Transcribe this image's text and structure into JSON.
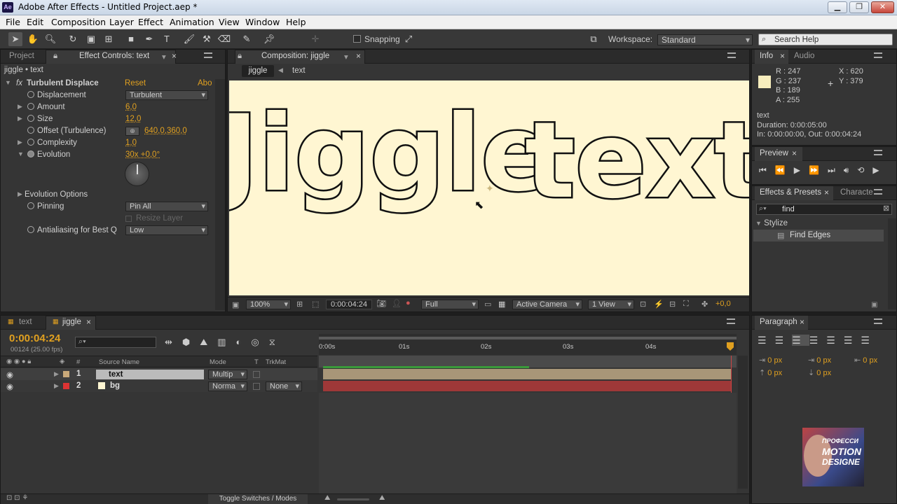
{
  "window": {
    "title": "Adobe After Effects - Untitled Project.aep *",
    "app_icon": "Ae"
  },
  "menu": [
    "File",
    "Edit",
    "Composition",
    "Layer",
    "Effect",
    "Animation",
    "View",
    "Window",
    "Help"
  ],
  "toolbar": {
    "snapping": "Snapping",
    "workspace_label": "Workspace:",
    "workspace_value": "Standard",
    "search_placeholder": "Search Help"
  },
  "project_panel": {
    "tab_project": "Project",
    "tab_effects": "Effect Controls: text",
    "breadcrumb": "jiggle • text"
  },
  "effect": {
    "name": "Turbulent Displace",
    "reset": "Reset",
    "about": "Abo",
    "displacement_label": "Displacement",
    "displacement_value": "Turbulent",
    "amount_label": "Amount",
    "amount_value": "6,0",
    "size_label": "Size",
    "size_value": "12,0",
    "offset_label": "Offset (Turbulence)",
    "offset_value": "640,0,360,0",
    "complexity_label": "Complexity",
    "complexity_value": "1,0",
    "evolution_label": "Evolution",
    "evolution_value": "30x +0,0°",
    "evolution_options": "Evolution Options",
    "pinning_label": "Pinning",
    "pinning_value": "Pin All",
    "resize_layer": "Resize Layer",
    "antialias_label": "Antialiasing for Best Q",
    "antialias_value": "Low"
  },
  "composition": {
    "tab": "Composition: jiggle",
    "crumb_1": "jiggle",
    "crumb_2": "text",
    "canvas_text_1": "Jiggle",
    "canvas_text_2": "text",
    "canvas_bg": "#fff6d2",
    "zoom": "100%",
    "timecode": "0:00:04:24",
    "resolution": "Full",
    "camera": "Active Camera",
    "views": "1 View",
    "exposure": "+0,0"
  },
  "info": {
    "tab_info": "Info",
    "tab_audio": "Audio",
    "r": "R : 247",
    "g": "G : 237",
    "b": "B : 189",
    "a": "A : 255",
    "x": "X : 620",
    "y": "Y : 379",
    "layer": "text",
    "duration": "Duration: 0:00:05:00",
    "inout": "In: 0:00:00:00, Out: 0:00:04:24",
    "swatch": "#f7edbd"
  },
  "preview": {
    "tab": "Preview"
  },
  "effects_presets": {
    "tab": "Effects & Presets",
    "tab2": "Characte",
    "search": "find",
    "category": "Stylize",
    "item": "Find Edges"
  },
  "timeline": {
    "tab_text": "text",
    "tab_jiggle": "jiggle",
    "timecode": "0:00:04:24",
    "fps": "00124 (25.00 fps)",
    "col_num": "#",
    "col_source": "Source Name",
    "col_mode": "Mode",
    "col_t": "T",
    "col_trkmat": "TrkMat",
    "ruler": [
      "0:00s",
      "01s",
      "02s",
      "03s",
      "04s"
    ],
    "layers": [
      {
        "num": "1",
        "name": "text",
        "mode": "Multip",
        "trkmat": "",
        "color": "#c9a97a",
        "bar": "#a89678"
      },
      {
        "num": "2",
        "name": "bg",
        "mode": "Norma",
        "trkmat": "None",
        "color": "#d33",
        "bar": "#9e3838"
      }
    ],
    "toggle": "Toggle Switches / Modes"
  },
  "paragraph": {
    "tab": "Paragraph",
    "f1": "0 px",
    "f2": "0 px",
    "f3": "0 px",
    "f4": "0 px",
    "f5": "0 px"
  },
  "watermark": {
    "line1": "ПРОФЕССИ",
    "line2": "MOTION",
    "line3": "DESIGNE"
  }
}
